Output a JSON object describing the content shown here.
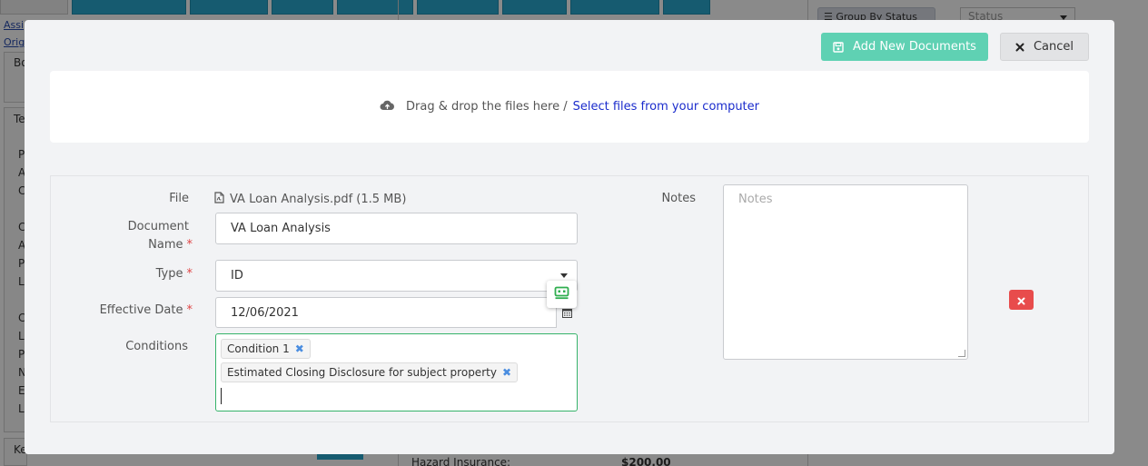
{
  "background": {
    "links": [
      "Assi",
      "Origi"
    ],
    "side_letters": [
      "Bo",
      "Te",
      "P",
      "A",
      "C",
      "C",
      "A",
      "P",
      "L",
      "C",
      "L",
      "P",
      "N",
      "E",
      "L",
      "Ke"
    ],
    "group_by_label": "Group By Status",
    "status_select_placeholder": "Status",
    "hazard_label": "Hazard Insurance:",
    "hazard_value": "$200.00"
  },
  "modal": {
    "add_button_label": "Add New Documents",
    "cancel_button_label": "Cancel",
    "dropzone": {
      "text": "Drag & drop the files here /",
      "select_link": "Select files from your computer"
    },
    "document": {
      "file_label": "File",
      "file_name": "VA Loan Analysis.pdf (1.5 MB)",
      "doc_name_label_line1": "Document",
      "doc_name_label_line2": "Name",
      "doc_name_value": "VA Loan Analysis",
      "type_label": "Type",
      "type_value": "ID",
      "effective_date_label": "Effective Date",
      "effective_date_value": "12/06/2021",
      "conditions_label": "Conditions",
      "conditions": [
        "Condition 1",
        "Estimated Closing Disclosure for subject property"
      ],
      "notes_label": "Notes",
      "notes_placeholder": "Notes",
      "required_marker": "*"
    }
  },
  "colors": {
    "accent_green": "#5fd1b3",
    "link_blue": "#1a2bcc",
    "danger_red": "#e84c4c",
    "focus_green": "#36b36a",
    "tab_blue": "#29a9cf"
  }
}
